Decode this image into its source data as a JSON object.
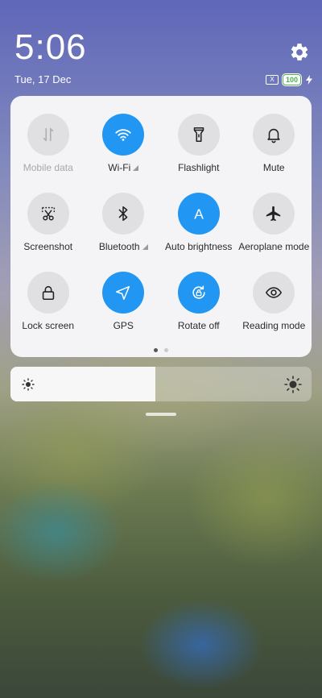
{
  "statusbar": {
    "time": "5:06",
    "date": "Tue, 17 Dec",
    "sim_label": "X",
    "battery_level": "100"
  },
  "tiles": [
    {
      "label": "Mobile data",
      "icon": "mobile-data-icon",
      "active": false,
      "dim": true
    },
    {
      "label": "Wi-Fi",
      "icon": "wifi-icon",
      "active": true,
      "has_arrow": true
    },
    {
      "label": "Flashlight",
      "icon": "flashlight-icon",
      "active": false
    },
    {
      "label": "Mute",
      "icon": "bell-icon",
      "active": false
    },
    {
      "label": "Screenshot",
      "icon": "scissors-icon",
      "active": false
    },
    {
      "label": "Bluetooth",
      "icon": "bluetooth-icon",
      "active": false,
      "has_arrow": true
    },
    {
      "label": "Auto brightness",
      "icon": "letter-a-icon",
      "active": true,
      "glyph": "A"
    },
    {
      "label": "Aeroplane mode",
      "icon": "airplane-icon",
      "active": false
    },
    {
      "label": "Lock screen",
      "icon": "lock-icon",
      "active": false
    },
    {
      "label": "GPS",
      "icon": "location-arrow-icon",
      "active": true
    },
    {
      "label": "Rotate off",
      "icon": "rotate-lock-icon",
      "active": true
    },
    {
      "label": "Reading mode",
      "icon": "eye-icon",
      "active": false
    }
  ],
  "pager": {
    "pages": 2,
    "current": 0
  },
  "brightness": {
    "level": 0.48
  },
  "colors": {
    "accent": "#2196f3",
    "tile_off": "#e0e0e3",
    "panel": "#f4f4f6",
    "battery": "#4caf50"
  }
}
